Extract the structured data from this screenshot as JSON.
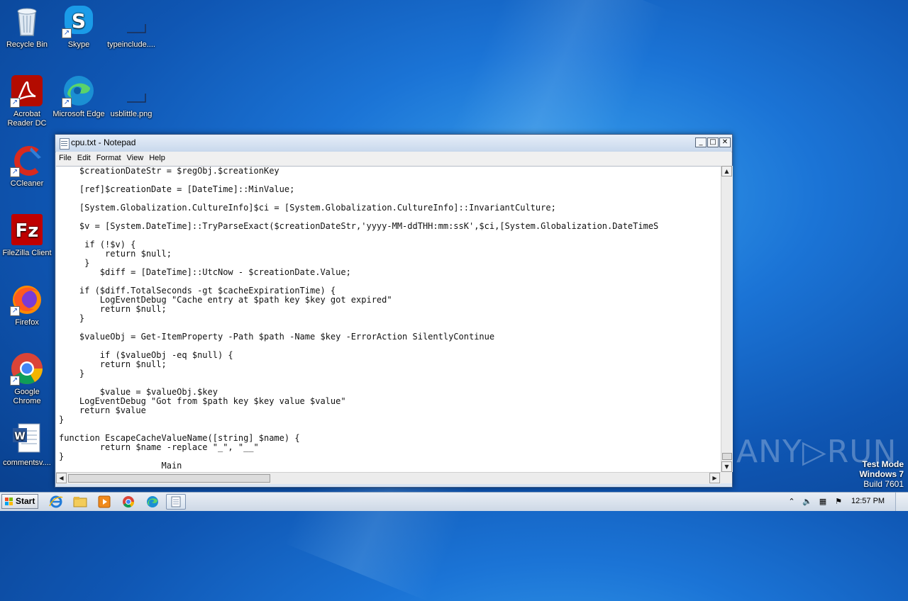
{
  "desktop": {
    "icons": [
      {
        "label": "Recycle Bin",
        "icon": "recycle-bin-icon"
      },
      {
        "label": "Skype",
        "icon": "skype-icon"
      },
      {
        "label": "typeinclude....",
        "icon": "file-icon"
      },
      {
        "label": "Acrobat Reader DC",
        "icon": "acrobat-icon"
      },
      {
        "label": "Microsoft Edge",
        "icon": "edge-icon"
      },
      {
        "label": "usblittle.png",
        "icon": "image-file-icon"
      },
      {
        "label": "CCleaner",
        "icon": "ccleaner-icon"
      },
      {
        "label": "FileZilla Client",
        "icon": "filezilla-icon"
      },
      {
        "label": "Firefox",
        "icon": "firefox-icon"
      },
      {
        "label": "Google Chrome",
        "icon": "chrome-icon"
      },
      {
        "label": "commentsv....",
        "icon": "word-doc-icon"
      }
    ]
  },
  "notepad": {
    "title": "cpu.txt - Notepad",
    "menu": [
      "File",
      "Edit",
      "Format",
      "View",
      "Help"
    ],
    "lines": [
      "    $creationDateStr = $regObj.$creationKey",
      "",
      "    [ref]$creationDate = [DateTime]::MinValue;",
      "",
      "    [System.Globalization.CultureInfo]$ci = [System.Globalization.CultureInfo]::InvariantCulture;",
      "",
      "    $v = [System.DateTime]::TryParseExact($creationDateStr,'yyyy-MM-ddTHH:mm:ssK',$ci,[System.Globalization.DateTimeS",
      "",
      "     if (!$v) {",
      "         return $null;",
      "     }",
      "        $diff = [DateTime]::UtcNow - $creationDate.Value;",
      "",
      "    if ($diff.TotalSeconds -gt $cacheExpirationTime) {",
      "        LogEventDebug \"Cache entry at $path key $key got expired\"",
      "        return $null;",
      "    }",
      "",
      "    $valueObj = Get-ItemProperty -Path $path -Name $key -ErrorAction SilentlyContinue",
      "",
      "        if ($valueObj -eq $null) {",
      "        return $null;",
      "    }",
      "",
      "        $value = $valueObj.$key",
      "    LogEventDebug \"Got from $path key $key value $value\"",
      "    return $value",
      "}",
      "",
      "function EscapeCacheValueName([string] $name) {",
      "        return $name -replace \"_\", \"__\"",
      "}",
      "                    Main"
    ]
  },
  "watermark": "ANY▷RUN",
  "test_mode": {
    "line1": "Test Mode",
    "line2": "Windows 7",
    "line3": "Build 7601"
  },
  "taskbar": {
    "start_label": "Start",
    "clock": "12:57 PM"
  }
}
